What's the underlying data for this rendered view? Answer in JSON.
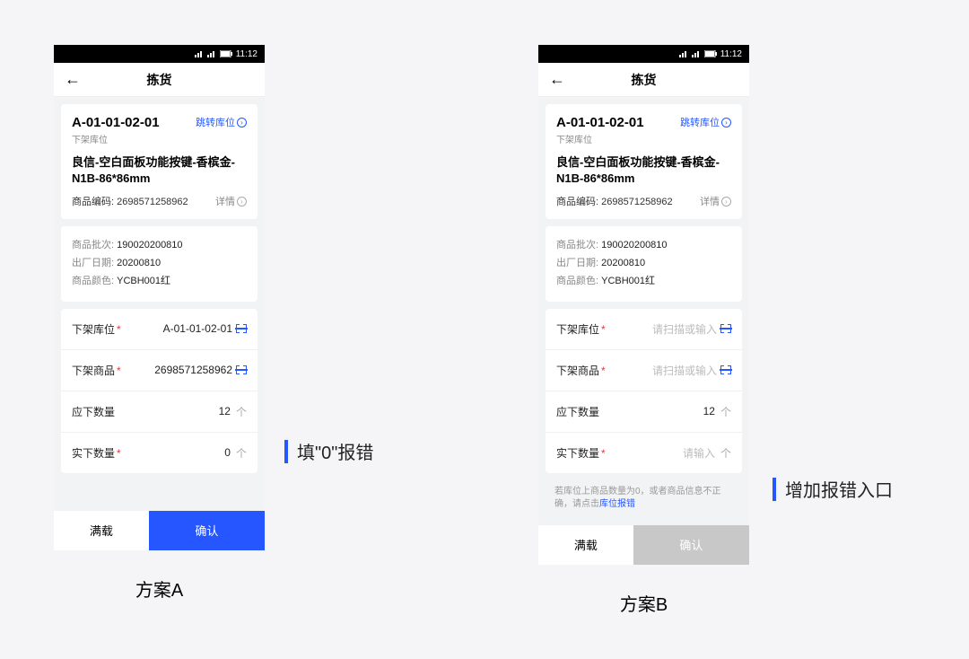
{
  "time": "11:12",
  "screens": {
    "a": {
      "title": "拣货",
      "location_code": "A-01-01-02-01",
      "location_sub": "下架库位",
      "jump_link": "跳转库位",
      "product_name": "良信-空白面板功能按键-香槟金-N1B-86*86mm",
      "product_code_label": "商品编码:",
      "product_code": "2698571258962",
      "detail_link": "详情",
      "batch_label": "商品批次:",
      "batch_value": "190020200810",
      "mfg_label": "出厂日期:",
      "mfg_value": "20200810",
      "color_label": "商品颜色:",
      "color_value": "YCBH001红",
      "form": {
        "loc_label": "下架库位",
        "loc_value": "A-01-01-02-01",
        "prod_label": "下架商品",
        "prod_value": "2698571258962",
        "should_label": "应下数量",
        "should_value": "12",
        "actual_label": "实下数量",
        "actual_value": "0",
        "unit": "个"
      },
      "btn_full": "满载",
      "btn_confirm": "确认",
      "plan": "方案A"
    },
    "b": {
      "title": "拣货",
      "location_code": "A-01-01-02-01",
      "location_sub": "下架库位",
      "jump_link": "跳转库位",
      "product_name": "良信-空白面板功能按键-香槟金-N1B-86*86mm",
      "product_code_label": "商品编码:",
      "product_code": "2698571258962",
      "detail_link": "详情",
      "batch_label": "商品批次:",
      "batch_value": "190020200810",
      "mfg_label": "出厂日期:",
      "mfg_value": "20200810",
      "color_label": "商品颜色:",
      "color_value": "YCBH001红",
      "form": {
        "loc_label": "下架库位",
        "loc_placeholder": "请扫描或输入",
        "prod_label": "下架商品",
        "prod_placeholder": "请扫描或输入",
        "should_label": "应下数量",
        "should_value": "12",
        "actual_label": "实下数量",
        "actual_placeholder": "请输入",
        "unit": "个"
      },
      "hint_prefix": "若库位上商品数量为0，或者商品信息不正确，请点击",
      "hint_link": "库位报错",
      "btn_full": "满载",
      "btn_confirm": "确认",
      "plan": "方案B"
    }
  },
  "annotations": {
    "a": "填\"0\"报错",
    "b": "增加报错入口"
  }
}
